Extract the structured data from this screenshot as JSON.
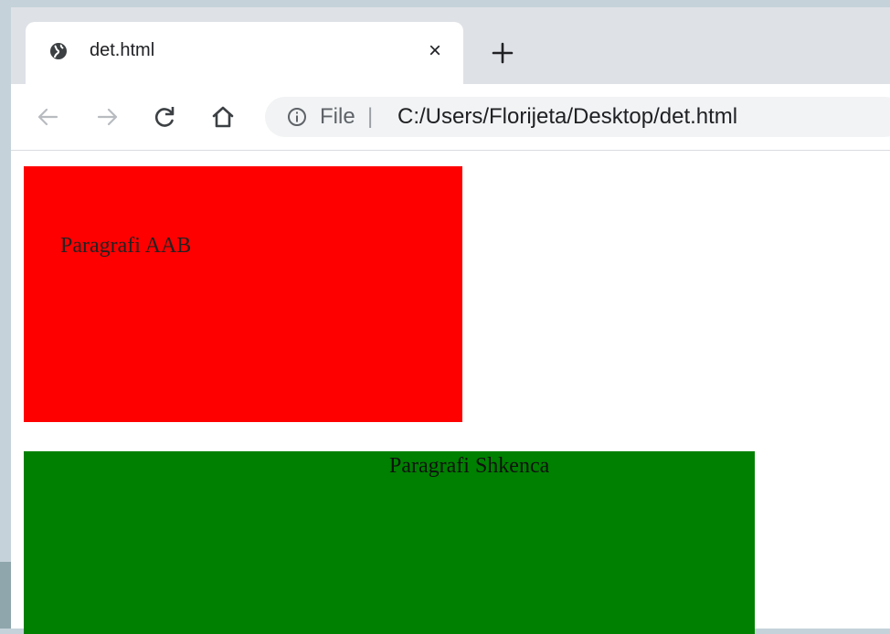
{
  "tab": {
    "title": "det.html",
    "favicon": "globe-icon",
    "close_glyph": "×"
  },
  "toolbar": {
    "back_icon": "arrow-left-icon",
    "forward_icon": "arrow-right-icon",
    "reload_icon": "reload-icon",
    "home_icon": "home-icon"
  },
  "omnibox": {
    "info_icon": "info-icon",
    "scheme": "File",
    "separator": "|",
    "url": "C:/Users/Florijeta/Desktop/det.html"
  },
  "page": {
    "red_box": {
      "color": "#ff0000",
      "text": "Paragrafi AAB"
    },
    "green_box": {
      "color": "#008000",
      "text": "Paragrafi Shkenca"
    }
  }
}
